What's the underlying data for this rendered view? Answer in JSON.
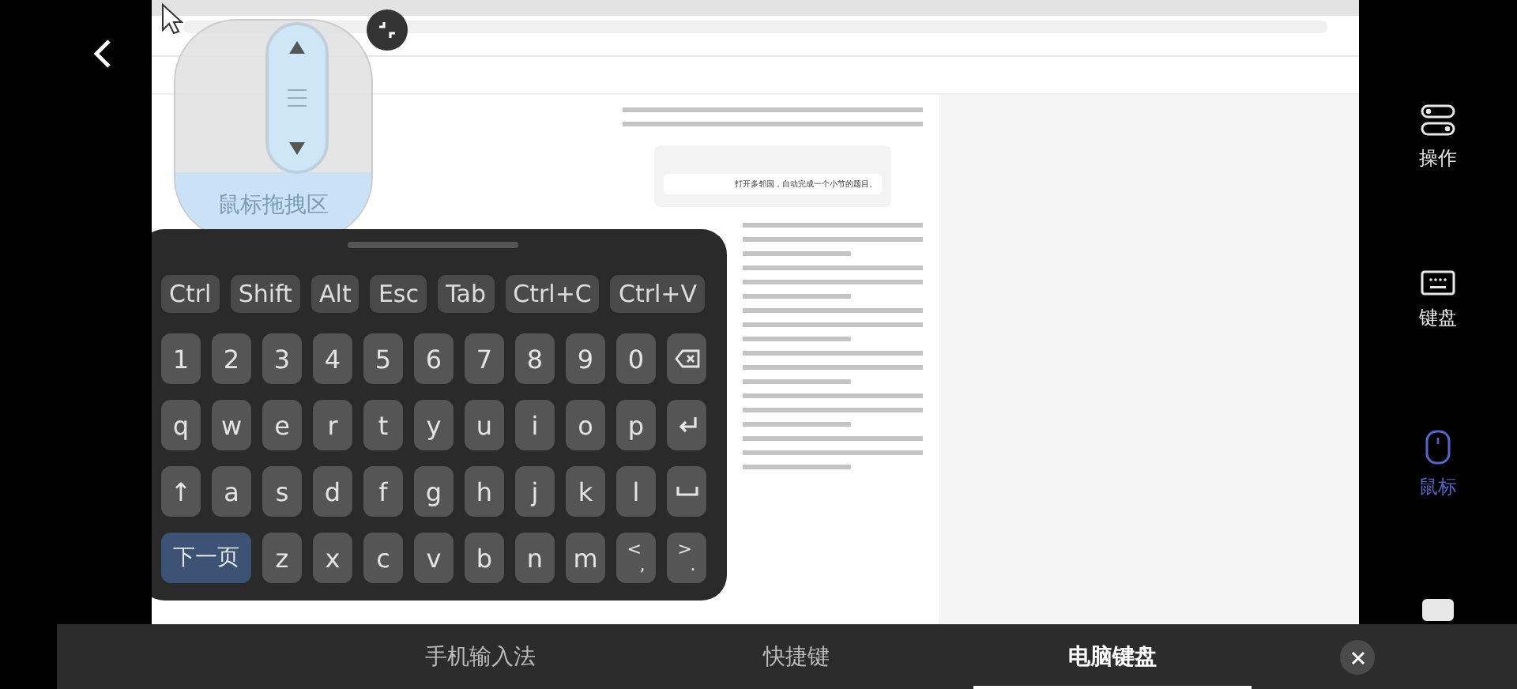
{
  "remote_screen": {
    "chat_message": "打开多邻国，自动完成一个小节的题目。"
  },
  "mouse_pad": {
    "label": "鼠标拖拽区"
  },
  "keyboard": {
    "modifier_keys": [
      "Ctrl",
      "Shift",
      "Alt",
      "Esc",
      "Tab",
      "Ctrl+C",
      "Ctrl+V"
    ],
    "rows": [
      [
        {
          "kind": "char",
          "label": "1"
        },
        {
          "kind": "char",
          "label": "2"
        },
        {
          "kind": "char",
          "label": "3"
        },
        {
          "kind": "char",
          "label": "4"
        },
        {
          "kind": "char",
          "label": "5"
        },
        {
          "kind": "char",
          "label": "6"
        },
        {
          "kind": "char",
          "label": "7"
        },
        {
          "kind": "char",
          "label": "8"
        },
        {
          "kind": "char",
          "label": "9"
        },
        {
          "kind": "char",
          "label": "0"
        },
        {
          "kind": "backspace"
        }
      ],
      [
        {
          "kind": "char",
          "label": "q"
        },
        {
          "kind": "char",
          "label": "w"
        },
        {
          "kind": "char",
          "label": "e"
        },
        {
          "kind": "char",
          "label": "r"
        },
        {
          "kind": "char",
          "label": "t"
        },
        {
          "kind": "char",
          "label": "y"
        },
        {
          "kind": "char",
          "label": "u"
        },
        {
          "kind": "char",
          "label": "i"
        },
        {
          "kind": "char",
          "label": "o"
        },
        {
          "kind": "char",
          "label": "p"
        },
        {
          "kind": "enter"
        }
      ],
      [
        {
          "kind": "char",
          "label": "↑"
        },
        {
          "kind": "char",
          "label": "a"
        },
        {
          "kind": "char",
          "label": "s"
        },
        {
          "kind": "char",
          "label": "d"
        },
        {
          "kind": "char",
          "label": "f"
        },
        {
          "kind": "char",
          "label": "g"
        },
        {
          "kind": "char",
          "label": "h"
        },
        {
          "kind": "char",
          "label": "j"
        },
        {
          "kind": "char",
          "label": "k"
        },
        {
          "kind": "char",
          "label": "l"
        },
        {
          "kind": "space"
        }
      ]
    ],
    "bottom_row": {
      "next_page_key": "下一页",
      "keys": [
        {
          "kind": "char",
          "label": "z"
        },
        {
          "kind": "char",
          "label": "x"
        },
        {
          "kind": "char",
          "label": "c"
        },
        {
          "kind": "char",
          "label": "v"
        },
        {
          "kind": "char",
          "label": "b"
        },
        {
          "kind": "char",
          "label": "n"
        },
        {
          "kind": "char",
          "label": "m"
        },
        {
          "kind": "dual",
          "top": "<",
          "bottom": ","
        },
        {
          "kind": "dual",
          "top": ">",
          "bottom": "."
        }
      ]
    }
  },
  "sidebar": [
    {
      "kind": "toggles",
      "label": "操作",
      "selected": false
    },
    {
      "kind": "keyboard",
      "label": "键盘",
      "selected": false
    },
    {
      "kind": "mouse",
      "label": "鼠标",
      "selected": true
    },
    {
      "kind": "card",
      "selected": false
    }
  ],
  "bottom_tabs": [
    {
      "label": "手机输入法",
      "selected": false
    },
    {
      "label": "快捷键",
      "selected": false
    },
    {
      "label": "电脑键盘",
      "selected": true
    }
  ]
}
